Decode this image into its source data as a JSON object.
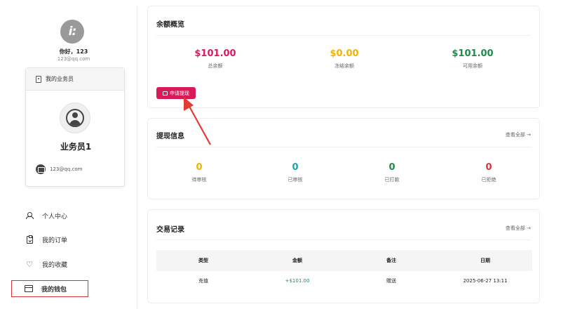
{
  "profile": {
    "greeting": "你好，123",
    "email": "123@qq.com"
  },
  "agent": {
    "section_title": "我的业务员",
    "name": "业务员1",
    "email": "123@qq.com"
  },
  "menu": {
    "items": [
      {
        "label": "个人中心",
        "icon": "person-icon"
      },
      {
        "label": "我的订单",
        "icon": "clipboard-icon"
      },
      {
        "label": "我的收藏",
        "icon": "heart-icon"
      },
      {
        "label": "我的钱包",
        "icon": "wallet-icon"
      }
    ]
  },
  "balance": {
    "title": "余额概览",
    "total_value": "$101.00",
    "total_label": "总余额",
    "frozen_value": "$0.00",
    "frozen_label": "冻结余额",
    "available_value": "$101.00",
    "available_label": "可用余额",
    "withdraw_label": "申请提现",
    "colors": {
      "total": "#d81b60",
      "frozen": "#f0b400",
      "available": "#1f8a4c"
    }
  },
  "withdrawals": {
    "title": "提现信息",
    "view_all": "查看全部 →",
    "stats": [
      {
        "value": "0",
        "label": "待审核",
        "color": "#f0b400"
      },
      {
        "value": "0",
        "label": "已审核",
        "color": "#17a2b8"
      },
      {
        "value": "0",
        "label": "已打款",
        "color": "#1f8a4c"
      },
      {
        "value": "0",
        "label": "已拒绝",
        "color": "#d9333b"
      }
    ]
  },
  "transactions": {
    "title": "交易记录",
    "view_all": "查看全部 →",
    "columns": [
      "类型",
      "金额",
      "备注",
      "日期"
    ],
    "rows": [
      {
        "type": "充值",
        "amount": "+$101.00",
        "note": "赠送",
        "date": "2025-06-27 13:11"
      }
    ]
  }
}
